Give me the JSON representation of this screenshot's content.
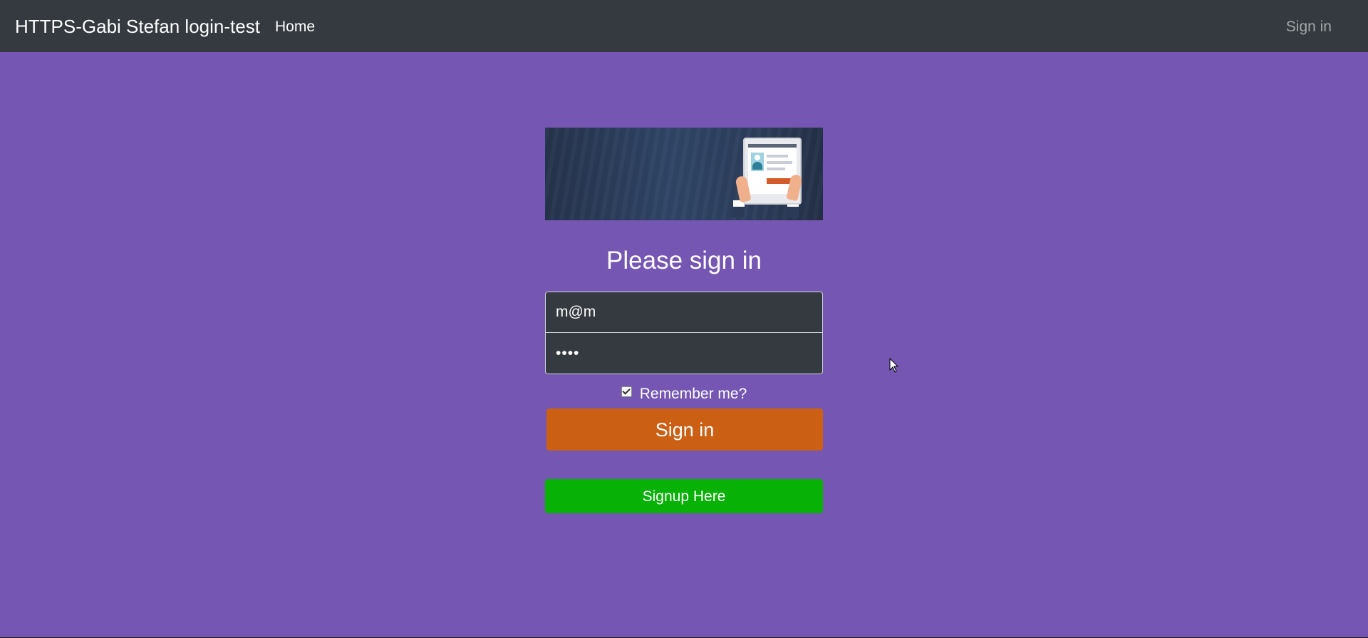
{
  "navbar": {
    "brand": "HTTPS-Gabi Stefan login-test",
    "home_label": "Home",
    "signin_label": "Sign in"
  },
  "form": {
    "title": "Please sign in",
    "email_value": "m@m",
    "password_value": "mmmm",
    "remember_label": "Remember me?",
    "remember_checked": true,
    "signin_button": "Sign in",
    "signup_button": "Signup Here"
  },
  "colors": {
    "background": "#7556b3",
    "navbar": "#343a40",
    "signin_button": "#cb6015",
    "signup_button": "#07b105",
    "input_background": "#343a40"
  }
}
